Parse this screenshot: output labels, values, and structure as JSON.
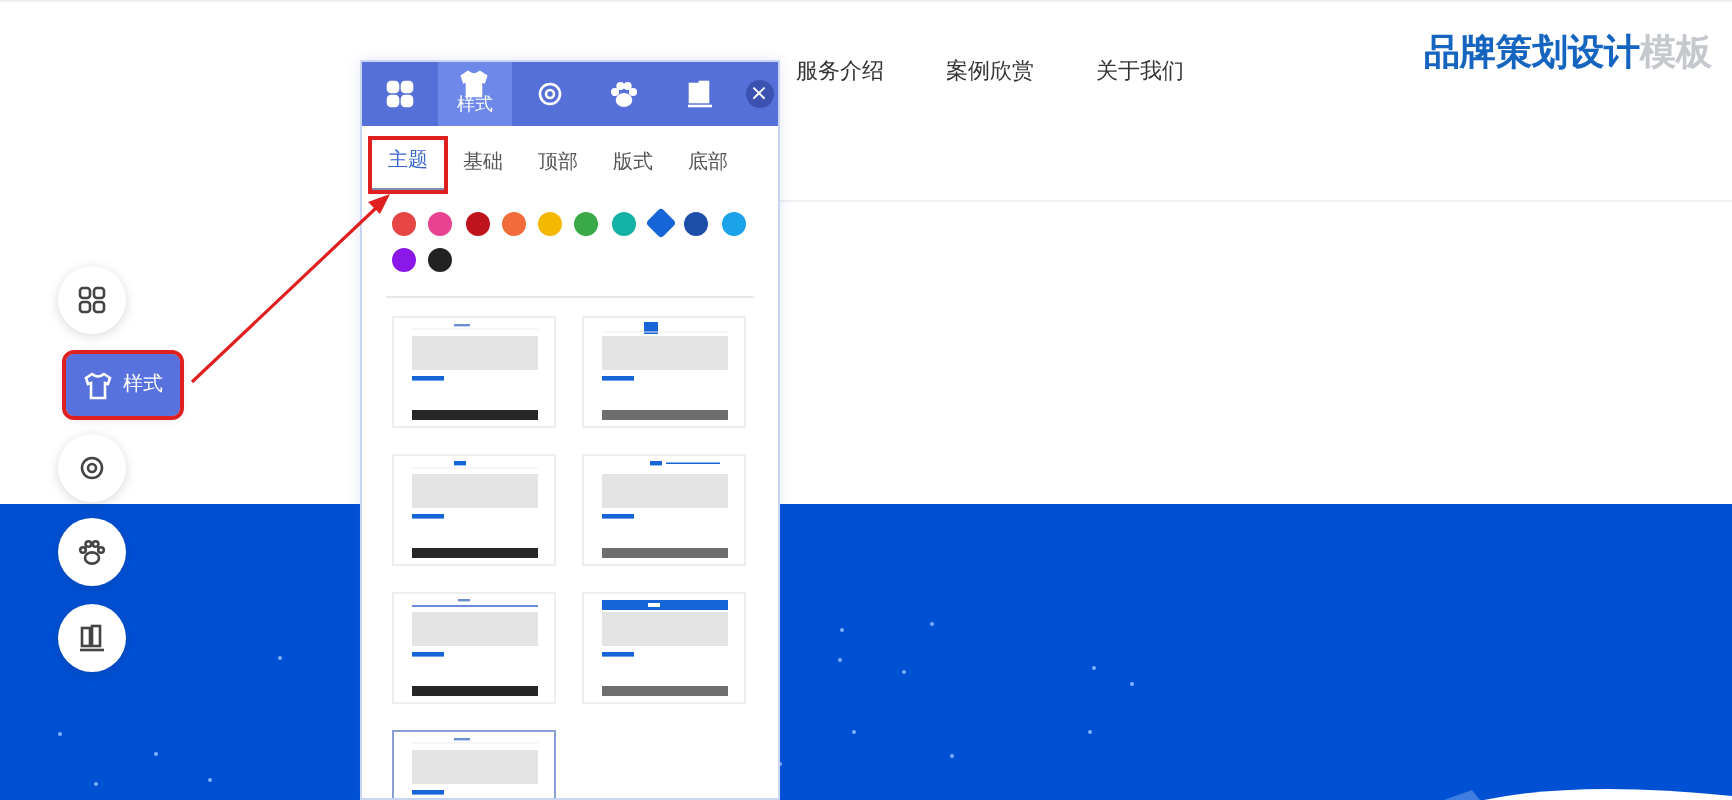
{
  "nav": {
    "items": [
      "服务介绍",
      "案例欣赏",
      "关于我们"
    ]
  },
  "logo": {
    "main": "品牌策划设计",
    "suffix": "模板"
  },
  "side_buttons": [
    {
      "kind": "grid",
      "selected": false,
      "highlighted": false
    },
    {
      "kind": "shirt",
      "label": "样式",
      "selected": true,
      "highlighted": true
    },
    {
      "kind": "gear",
      "selected": false,
      "highlighted": false
    },
    {
      "kind": "paw",
      "selected": false,
      "highlighted": false
    },
    {
      "kind": "books",
      "selected": false,
      "highlighted": false
    }
  ],
  "panel": {
    "tabs": [
      {
        "kind": "grid",
        "selected": false
      },
      {
        "kind": "shirt",
        "label": "样式",
        "selected": true
      },
      {
        "kind": "gear",
        "selected": false
      },
      {
        "kind": "paw",
        "selected": false
      },
      {
        "kind": "books",
        "selected": false
      }
    ],
    "close": "×",
    "subtabs": [
      {
        "label": "主题",
        "selected": true,
        "highlighted": true
      },
      {
        "label": "基础",
        "selected": false,
        "highlighted": false
      },
      {
        "label": "顶部",
        "selected": false,
        "highlighted": false
      },
      {
        "label": "版式",
        "selected": false,
        "highlighted": false
      },
      {
        "label": "底部",
        "selected": false,
        "highlighted": false
      }
    ],
    "swatches": [
      {
        "color": "#e84545",
        "selected": false
      },
      {
        "color": "#e84393",
        "selected": false
      },
      {
        "color": "#c0141c",
        "selected": false
      },
      {
        "color": "#f26b3a",
        "selected": false
      },
      {
        "color": "#f5b800",
        "selected": false
      },
      {
        "color": "#3aaa49",
        "selected": false
      },
      {
        "color": "#14b1a6",
        "selected": false
      },
      {
        "color": "#1565d8",
        "selected": true
      },
      {
        "color": "#1e4fa8",
        "selected": false
      },
      {
        "color": "#1aa3e8",
        "selected": false
      },
      {
        "color": "#8a18e8",
        "selected": false
      },
      {
        "color": "#222222",
        "selected": false
      }
    ],
    "templates": [
      {
        "kind": "classic",
        "selected": false
      },
      {
        "kind": "logoblock",
        "selected": false
      },
      {
        "kind": "pill",
        "selected": false
      },
      {
        "kind": "pillrule",
        "selected": false
      },
      {
        "kind": "rule",
        "selected": false
      },
      {
        "kind": "banner",
        "selected": false
      },
      {
        "kind": "classic",
        "selected": true
      }
    ]
  }
}
